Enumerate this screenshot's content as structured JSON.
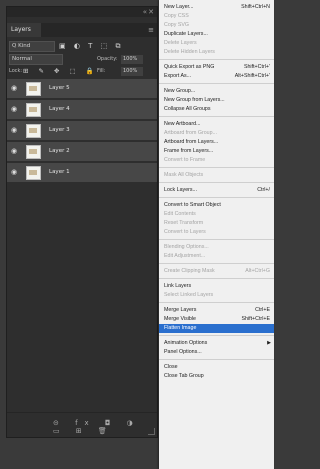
{
  "layers_panel": {
    "collapse_icon": "double-chevron-icon",
    "close_icon": "close-icon",
    "tab_label": "Layers",
    "menu_icon": "panel-menu-icon",
    "filter": {
      "kind_label": "Q Kind",
      "icons": [
        "image-filter-icon",
        "adjustment-filter-icon",
        "type-filter-icon",
        "shape-filter-icon",
        "smart-object-filter-icon"
      ],
      "icon_glyphs": "▣ ◐ T ⬚ ⧉"
    },
    "blend": {
      "mode": "Normal",
      "opacity_label": "Opacity:",
      "opacity_value": "100%"
    },
    "lock": {
      "label": "Lock:",
      "icon_glyphs": "⊞ ✎ ✥ ⬚ 🔒",
      "fill_label": "Fill:",
      "fill_value": "100%"
    },
    "layers": [
      {
        "name": "Layer 5"
      },
      {
        "name": "Layer 4"
      },
      {
        "name": "Layer 3"
      },
      {
        "name": "Layer 2"
      },
      {
        "name": "Layer 1"
      }
    ],
    "footer_icon_glyphs": "⊝ fx ◘ ◑ ▭ ⊞ 🗑"
  },
  "context_menu": {
    "highlight_color": "#2a6fce",
    "groups": [
      [
        {
          "label": "New Layer...",
          "shortcut": "Shift+Ctrl+N",
          "enabled": true
        },
        {
          "label": "Copy CSS",
          "enabled": false
        },
        {
          "label": "Copy SVG",
          "enabled": false
        },
        {
          "label": "Duplicate Layers...",
          "enabled": true
        },
        {
          "label": "Delete Layers",
          "enabled": false
        },
        {
          "label": "Delete Hidden Layers",
          "enabled": false
        }
      ],
      [
        {
          "label": "Quick Export as PNG",
          "shortcut": "Shift+Ctrl+'",
          "enabled": true
        },
        {
          "label": "Export As...",
          "shortcut": "Alt+Shift+Ctrl+'",
          "enabled": true
        }
      ],
      [
        {
          "label": "New Group...",
          "enabled": true
        },
        {
          "label": "New Group from Layers...",
          "enabled": true
        },
        {
          "label": "Collapse All Groups",
          "enabled": true
        }
      ],
      [
        {
          "label": "New Artboard...",
          "enabled": true
        },
        {
          "label": "Artboard from Group...",
          "enabled": false
        },
        {
          "label": "Artboard from Layers...",
          "enabled": true
        },
        {
          "label": "Frame from Layers...",
          "enabled": true
        },
        {
          "label": "Convert to Frame",
          "enabled": false
        }
      ],
      [
        {
          "label": "Mask All Objects",
          "enabled": false
        }
      ],
      [
        {
          "label": "Lock Layers...",
          "shortcut": "Ctrl+/",
          "enabled": true
        }
      ],
      [
        {
          "label": "Convert to Smart Object",
          "enabled": true
        },
        {
          "label": "Edit Contents",
          "enabled": false
        },
        {
          "label": "Reset Transform",
          "enabled": false
        },
        {
          "label": "Convert to Layers",
          "enabled": false
        }
      ],
      [
        {
          "label": "Blending Options...",
          "enabled": false
        },
        {
          "label": "Edit Adjustment...",
          "enabled": false
        }
      ],
      [
        {
          "label": "Create Clipping Mask",
          "shortcut": "Alt+Ctrl+G",
          "enabled": false
        }
      ],
      [
        {
          "label": "Link Layers",
          "enabled": true
        },
        {
          "label": "Select Linked Layers",
          "enabled": false
        }
      ],
      [
        {
          "label": "Merge Layers",
          "shortcut": "Ctrl+E",
          "enabled": true
        },
        {
          "label": "Merge Visible",
          "shortcut": "Shift+Ctrl+E",
          "enabled": true
        },
        {
          "label": "Flatten Image",
          "enabled": true,
          "highlighted": true
        }
      ],
      [
        {
          "label": "Animation Options",
          "enabled": true,
          "submenu": true
        },
        {
          "label": "Panel Options...",
          "enabled": true
        }
      ],
      [
        {
          "label": "Close",
          "enabled": true
        },
        {
          "label": "Close Tab Group",
          "enabled": true
        }
      ]
    ]
  }
}
